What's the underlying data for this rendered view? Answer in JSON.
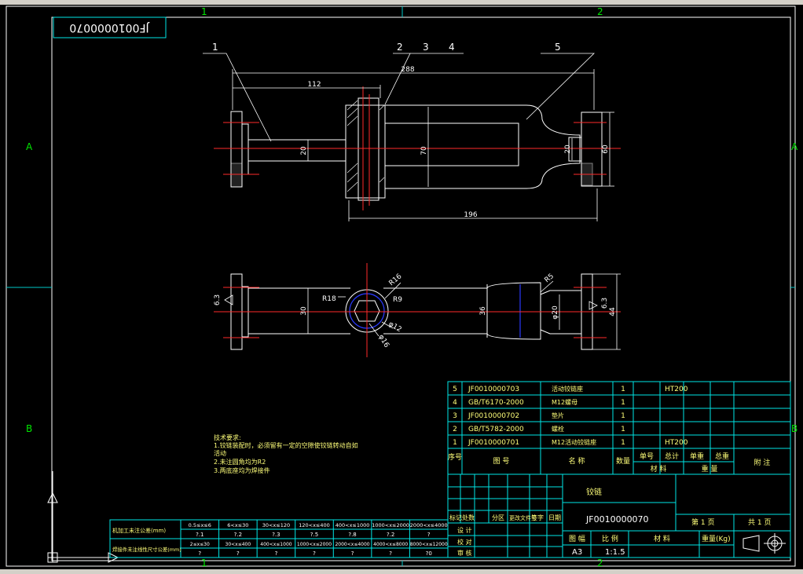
{
  "drawing": {
    "code_stamp": "JF0010000070",
    "zone_cols": [
      "1",
      "2"
    ],
    "zone_rows": [
      "A",
      "B"
    ],
    "balloons": [
      "1",
      "2",
      "3",
      "4",
      "5"
    ],
    "dims_top": [
      "288",
      "112",
      "20",
      "70",
      "20",
      "60",
      "196"
    ],
    "dims_bottom": [
      "6.3",
      "30",
      "R18",
      "R16",
      "R9",
      "φ12",
      "φ16",
      "36",
      "R5",
      "φ20",
      "6.3",
      "44"
    ],
    "tech_notes": [
      "技术要求:",
      "1.铰链装配时，必须留有一定的空隙使铰链转动自如",
      "  活动",
      "2.未注圆角均为R2",
      "3.两底座均为焊接件"
    ],
    "colors": {
      "line": "#ffffff",
      "center": "#ff2a2a",
      "dim": "#ffffff",
      "table": "#00e6e6",
      "text": "#ffff7a",
      "zone": "#00e600",
      "circle": "#2a3aff"
    }
  },
  "bom": [
    {
      "no": "5",
      "code": "JF0010000703",
      "name": "活动铰链座",
      "qty": "1",
      "material": "HT200"
    },
    {
      "no": "4",
      "code": "GB/T6170-2000",
      "name": "M12螺母",
      "qty": "1",
      "material": ""
    },
    {
      "no": "3",
      "code": "JF0010000702",
      "name": "垫片",
      "qty": "1",
      "material": ""
    },
    {
      "no": "2",
      "code": "GB/T5782-2000",
      "name": "螺栓",
      "qty": "1",
      "material": ""
    },
    {
      "no": "1",
      "code": "JF0010000701",
      "name": "M12活动铰链座",
      "qty": "1",
      "material": "HT200"
    }
  ],
  "bom_header": {
    "no": "序号",
    "code": "图 号",
    "name": "名 称",
    "qty": "数量",
    "single": "单号",
    "total": "总计",
    "material": "材 料",
    "weight": "重 量",
    "note": "附 注",
    "unit_w": "单重",
    "total_w": "总重"
  },
  "title_block": {
    "part_name": "铰链",
    "drawing_no": "JF0010000070",
    "sheet_label": "第 1 页",
    "total_label": "共 1 页",
    "mark_label": "图 幅",
    "scale_label": "比 例",
    "material_label": "材 料",
    "weight_label": "重量(Kg)",
    "format": "A3",
    "scale": "1:1.5",
    "sign_row": [
      "标记",
      "处数",
      "分区",
      "更改文件号",
      "签字",
      "日期"
    ],
    "roles": [
      "设 计",
      "校 对",
      "审 核"
    ]
  },
  "tolerance_table": {
    "row1_label": "机加工未注公差(mm)",
    "row1_ranges": [
      "0.5≤x≤6",
      "6<x≤30",
      "30<x≤120",
      "120<x≤400",
      "400<x≤1000",
      "1000<x≤2000",
      "2000<x≤4000"
    ],
    "row1_values": [
      "?.1",
      "?.2",
      "?.3",
      "?.5",
      "?.8",
      "?.2",
      "?"
    ],
    "row2_label": "焊接件未注线性尺寸公差(mm)",
    "row2_ranges": [
      "2≤x≤30",
      "30<x≤400",
      "400<x≤1000",
      "1000<x≤2000",
      "2000<x≤4000",
      "4000<x≤8000",
      "8000<x≤12000"
    ],
    "row2_values": [
      "?",
      "?",
      "?",
      "?",
      "?",
      "?",
      "?0"
    ]
  }
}
